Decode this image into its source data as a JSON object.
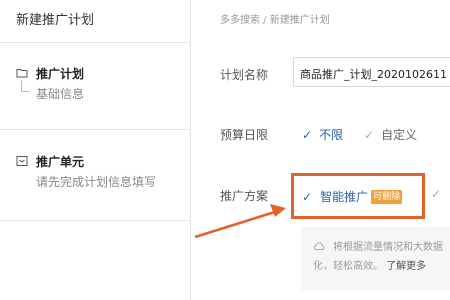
{
  "sidebar": {
    "title": "新建推广计划",
    "sections": [
      {
        "heading": "推广计划",
        "sub": "基础信息",
        "icon": "folder-icon"
      },
      {
        "heading": "推广单元",
        "sub": "请先完成计划信息填写",
        "icon": "inbox-icon"
      }
    ]
  },
  "breadcrumb": "多多搜索 / 新建推广计划",
  "form": {
    "plan_name_label": "计划名称",
    "plan_name_value": "商品推广_计划_2020102611",
    "budget_label": "预算日限",
    "budget_options": [
      "不限",
      "自定义"
    ],
    "scheme_label": "推广方案",
    "scheme_selected": "智能推广",
    "scheme_badge": "可删除"
  },
  "info": {
    "line1": "将根据流量情况和大数据",
    "line2": "化，轻松高效。",
    "link": "了解更多"
  },
  "colors": {
    "accent": "#2a5db0",
    "highlight_border": "#e2622a",
    "badge": "#f0a23a"
  }
}
